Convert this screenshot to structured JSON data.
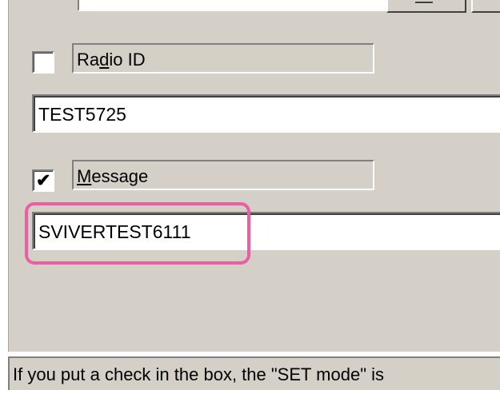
{
  "radio_id": {
    "label_prefix": "Ra",
    "label_accel": "d",
    "label_suffix": "io ID",
    "checked": false,
    "value": "TEST5725"
  },
  "message": {
    "label_accel": "M",
    "label_suffix": "essage",
    "checkmark": "✔",
    "checked": true,
    "value": "SVIVERTEST6111"
  },
  "status_bar": {
    "text": "If you put a check in the box, the \"SET mode\" is"
  },
  "colors": {
    "dialog_bg": "#d4d0c8",
    "highlight": "#ea5fa2"
  }
}
